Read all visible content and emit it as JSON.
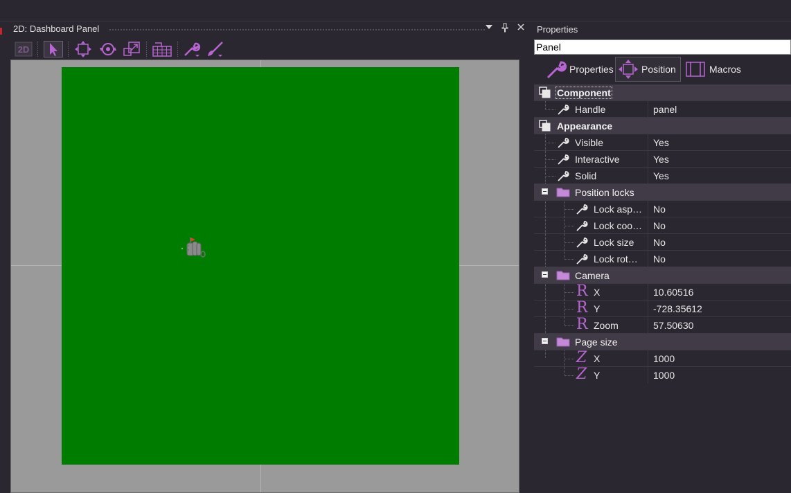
{
  "dashboard": {
    "title": "2D: Dashboard Panel",
    "page_color": "#007d00"
  },
  "properties": {
    "title": "Properties",
    "name_value": "Panel",
    "tabs": [
      {
        "label": "Properties"
      },
      {
        "label": "Position"
      },
      {
        "label": "Macros"
      }
    ],
    "rows": {
      "component": "Component",
      "handle": {
        "label": "Handle",
        "value": "panel"
      },
      "appearance": "Appearance",
      "visible": {
        "label": "Visible",
        "value": "Yes"
      },
      "interactive": {
        "label": "Interactive",
        "value": "Yes"
      },
      "solid": {
        "label": "Solid",
        "value": "Yes"
      },
      "position_locks": "Position locks",
      "lock_aspect": {
        "label": "Lock asp…",
        "value": "No"
      },
      "lock_coords": {
        "label": "Lock coo…",
        "value": "No"
      },
      "lock_size": {
        "label": "Lock size",
        "value": "No"
      },
      "lock_rotation": {
        "label": "Lock rot…",
        "value": "No"
      },
      "camera": "Camera",
      "camera_x": {
        "label": "X",
        "value": "10.60516"
      },
      "camera_y": {
        "label": "Y",
        "value": "-728.35612"
      },
      "camera_zoom": {
        "label": "Zoom",
        "value": "57.50630"
      },
      "page_size": "Page size",
      "page_x": {
        "label": "X",
        "value": "1000"
      },
      "page_y": {
        "label": "Y",
        "value": "1000"
      }
    }
  },
  "accent_color": "#b766d1"
}
